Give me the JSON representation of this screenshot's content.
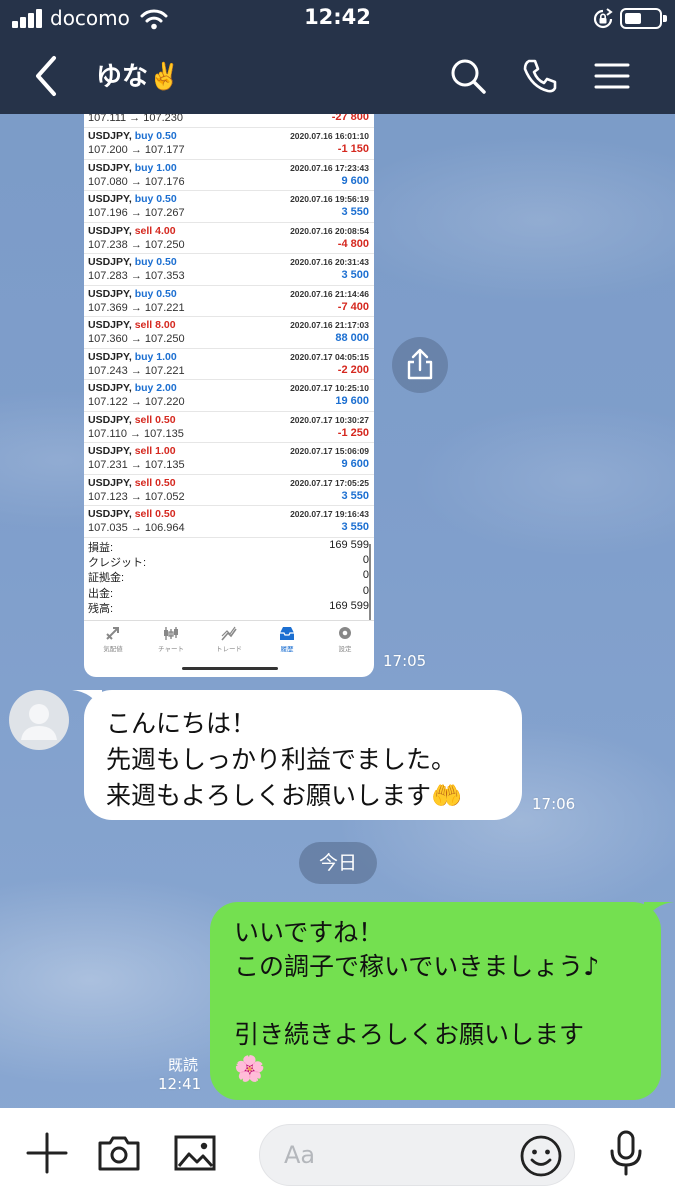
{
  "status_bar": {
    "carrier": "docomo",
    "time": "12:42"
  },
  "header": {
    "title": "ゆな✌️"
  },
  "screenshot": {
    "partial_top_row": {
      "price": "107.111 → 107.230",
      "pl": "-27 800"
    },
    "trades": [
      {
        "symbol": "USDJPY,",
        "side": "buy",
        "lots": "0.50",
        "datetime": "2020.07.16 16:01:10",
        "prices": "107.200 → 107.177",
        "pl": "-1 150"
      },
      {
        "symbol": "USDJPY,",
        "side": "buy",
        "lots": "1.00",
        "datetime": "2020.07.16 17:23:43",
        "prices": "107.080 → 107.176",
        "pl": "9 600"
      },
      {
        "symbol": "USDJPY,",
        "side": "buy",
        "lots": "0.50",
        "datetime": "2020.07.16 19:56:19",
        "prices": "107.196 → 107.267",
        "pl": "3 550"
      },
      {
        "symbol": "USDJPY,",
        "side": "sell",
        "lots": "4.00",
        "datetime": "2020.07.16 20:08:54",
        "prices": "107.238 → 107.250",
        "pl": "-4 800"
      },
      {
        "symbol": "USDJPY,",
        "side": "buy",
        "lots": "0.50",
        "datetime": "2020.07.16 20:31:43",
        "prices": "107.283 → 107.353",
        "pl": "3 500"
      },
      {
        "symbol": "USDJPY,",
        "side": "buy",
        "lots": "0.50",
        "datetime": "2020.07.16 21:14:46",
        "prices": "107.369 → 107.221",
        "pl": "-7 400"
      },
      {
        "symbol": "USDJPY,",
        "side": "sell",
        "lots": "8.00",
        "datetime": "2020.07.16 21:17:03",
        "prices": "107.360 → 107.250",
        "pl": "88 000"
      },
      {
        "symbol": "USDJPY,",
        "side": "buy",
        "lots": "1.00",
        "datetime": "2020.07.17 04:05:15",
        "prices": "107.243 → 107.221",
        "pl": "-2 200"
      },
      {
        "symbol": "USDJPY,",
        "side": "buy",
        "lots": "2.00",
        "datetime": "2020.07.17 10:25:10",
        "prices": "107.122 → 107.220",
        "pl": "19 600"
      },
      {
        "symbol": "USDJPY,",
        "side": "sell",
        "lots": "0.50",
        "datetime": "2020.07.17 10:30:27",
        "prices": "107.110 → 107.135",
        "pl": "-1 250"
      },
      {
        "symbol": "USDJPY,",
        "side": "sell",
        "lots": "1.00",
        "datetime": "2020.07.17 15:06:09",
        "prices": "107.231 → 107.135",
        "pl": "9 600"
      },
      {
        "symbol": "USDJPY,",
        "side": "sell",
        "lots": "0.50",
        "datetime": "2020.07.17 17:05:25",
        "prices": "107.123 → 107.052",
        "pl": "3 550"
      },
      {
        "symbol": "USDJPY,",
        "side": "sell",
        "lots": "0.50",
        "datetime": "2020.07.17 19:16:43",
        "prices": "107.035 → 106.964",
        "pl": "3 550"
      }
    ],
    "summary": [
      {
        "label": "損益:",
        "value": "169 599"
      },
      {
        "label": "クレジット:",
        "value": "0"
      },
      {
        "label": "証拠金:",
        "value": "0"
      },
      {
        "label": "出金:",
        "value": "0"
      },
      {
        "label": "残高:",
        "value": "169 599"
      }
    ],
    "tabs": [
      {
        "label": "気配値",
        "icon": "quotes-icon"
      },
      {
        "label": "チャート",
        "icon": "candles-icon"
      },
      {
        "label": "トレード",
        "icon": "trade-icon"
      },
      {
        "label": "履歴",
        "icon": "history-icon",
        "active": true
      },
      {
        "label": "設定",
        "icon": "settings-icon"
      }
    ]
  },
  "messages": {
    "image_time": "17:05",
    "incoming": {
      "lines": [
        "こんにちは！",
        "先週もしっかり利益でました。",
        "来週もよろしくお願いします🤲"
      ],
      "time": "17:06"
    },
    "date_separator": "今日",
    "outgoing": {
      "text": "いいですね！\nこの調子で稼いでいきましょう♪\n\n引き続きよろしくお願いします\n🌸",
      "read_label": "既読",
      "time": "12:41"
    }
  },
  "input_bar": {
    "placeholder": "Aa"
  },
  "colors": {
    "header_bg": "#263349",
    "outgoing_bubble": "#74e050",
    "buy": "#1c6fd1",
    "sell": "#d5281f"
  }
}
